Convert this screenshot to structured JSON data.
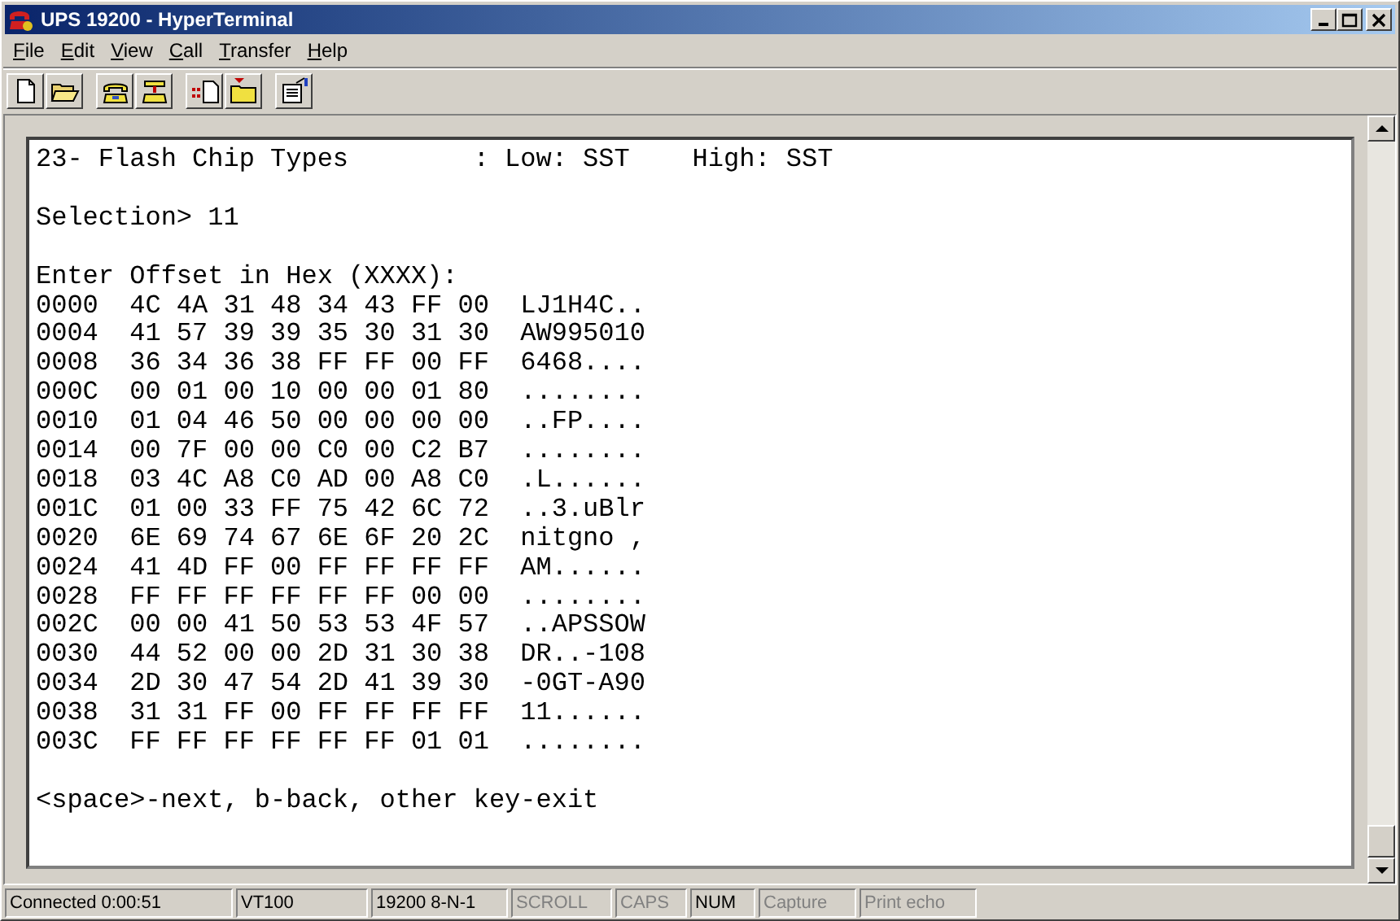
{
  "window": {
    "title": "UPS 19200 - HyperTerminal"
  },
  "menu": [
    "File",
    "Edit",
    "View",
    "Call",
    "Transfer",
    "Help"
  ],
  "toolbar": [
    {
      "kind": "new"
    },
    {
      "kind": "open"
    },
    {
      "kind": "sep"
    },
    {
      "kind": "call"
    },
    {
      "kind": "hangup"
    },
    {
      "kind": "sep"
    },
    {
      "kind": "send"
    },
    {
      "kind": "receive"
    },
    {
      "kind": "sep"
    },
    {
      "kind": "properties"
    }
  ],
  "terminal": {
    "blocks": [
      [
        "23- Flash Chip Types        : Low: SST    High: SST"
      ],
      [
        "Selection> 11"
      ],
      [
        "Enter Offset in Hex (XXXX):",
        "0000  4C 4A 31 48 34 43 FF 00  LJ1H4C..",
        "0004  41 57 39 39 35 30 31 30  AW995010",
        "0008  36 34 36 38 FF FF 00 FF  6468....",
        "000C  00 01 00 10 00 00 01 80  ........",
        "0010  01 04 46 50 00 00 00 00  ..FP....",
        "0014  00 7F 00 00 C0 00 C2 B7  ........",
        "0018  03 4C A8 C0 AD 00 A8 C0  .L......",
        "001C  01 00 33 FF 75 42 6C 72  ..3.uBlr",
        "0020  6E 69 74 67 6E 6F 20 2C  nitgno ,",
        "0024  41 4D FF 00 FF FF FF FF  AM......",
        "0028  FF FF FF FF FF FF 00 00  ........",
        "002C  00 00 41 50 53 53 4F 57  ..APSSOW",
        "0030  44 52 00 00 2D 31 30 38  DR..-108",
        "0034  2D 30 47 54 2D 41 39 30  -0GT-A90",
        "0038  31 31 FF 00 FF FF FF FF  11......",
        "003C  FF FF FF FF FF FF 01 01  ........"
      ],
      [
        "<space>-next, b-back, other key-exit"
      ]
    ]
  },
  "status_bar": [
    {
      "text": "Connected 0:00:51",
      "disabled": false
    },
    {
      "text": "VT100",
      "disabled": false
    },
    {
      "text": "19200 8-N-1",
      "disabled": false
    },
    {
      "text": "SCROLL",
      "disabled": true
    },
    {
      "text": "CAPS",
      "disabled": true
    },
    {
      "text": "NUM",
      "disabled": false
    },
    {
      "text": "Capture",
      "disabled": true
    },
    {
      "text": "Print echo",
      "disabled": true
    }
  ]
}
